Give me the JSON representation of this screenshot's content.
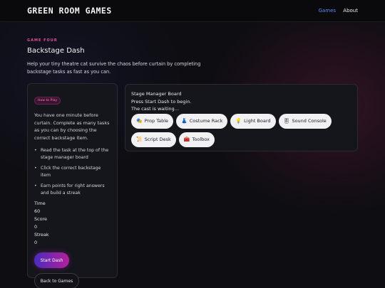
{
  "header": {
    "brand": "GREEN ROOM GAMES",
    "nav": [
      "Games",
      "About"
    ]
  },
  "hero": {
    "eyebrow": "GAME FOUR",
    "title": "Backstage Dash",
    "description": "Help your tiny theatre cat survive the chaos before curtain by completing backstage tasks as fast as you can."
  },
  "howto": {
    "badge": "How to Play",
    "text": "You have one minute before curtain. Complete as many tasks as you can by choosing the correct backstage item.",
    "steps": [
      "Read the task at the top of the stage manager board",
      "Click the correct backstage item",
      "Earn points for right answers and build a streak"
    ],
    "time_label": "Time",
    "time_value": "60",
    "score_label": "Score",
    "score_value": "0",
    "streak_label": "Streak",
    "streak_value": "0",
    "start_label": "Start Dash",
    "back_label": "Back to Games"
  },
  "board": {
    "title": "Stage Manager Board",
    "prompt": "Press Start Dash to begin.",
    "status": "The cast is waiting…",
    "items": [
      {
        "icon": "🎭",
        "label": "Prop Table"
      },
      {
        "icon": "👗",
        "label": "Costume Rack"
      },
      {
        "icon": "💡",
        "label": "Light Board"
      },
      {
        "icon": "🎚",
        "label": "Sound Console"
      },
      {
        "icon": "📜",
        "label": "Script Desk"
      },
      {
        "icon": "🧰",
        "label": "Toolbox"
      }
    ]
  },
  "colors": {
    "accent_pink": "#e0509a",
    "nav_active": "#5b8cff",
    "start_gradient_from": "#4a2bbf",
    "start_gradient_to": "#b3209b"
  }
}
